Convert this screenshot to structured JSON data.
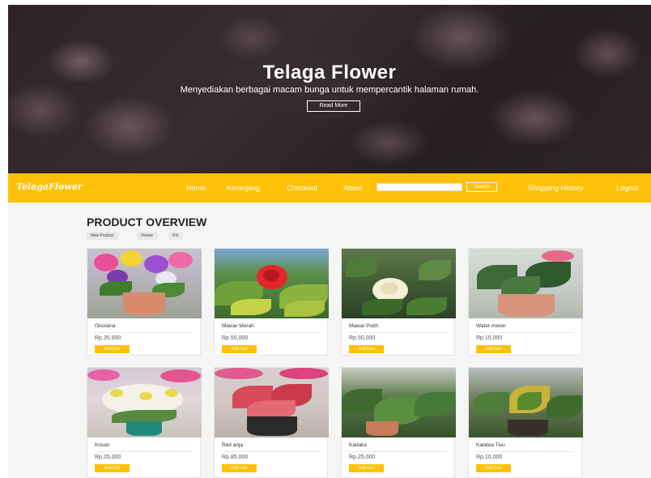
{
  "hero": {
    "title": "Telaga Flower",
    "subtitle": "Menyediakan berbagai macam bunga untuk mempercantik halaman rumah.",
    "button": "Read More"
  },
  "navbar": {
    "brand": "TelagaFlower",
    "links": [
      "Home",
      "Keranjang",
      "Checkout",
      "About"
    ],
    "search_button": "Search",
    "history": "Shopping History",
    "logout": "Logout"
  },
  "overview": {
    "title": "PRODUCT OVERVIEW",
    "filters": [
      "New Product",
      "Flower",
      "Pot"
    ]
  },
  "products": [
    {
      "name": "Gloxiana",
      "price": "Rp.35,000",
      "button": "Add Cart"
    },
    {
      "name": "Mawar Merah",
      "price": "Rp.50,000",
      "button": "Add Cart"
    },
    {
      "name": "Mawar Putih",
      "price": "Rp.50,000",
      "button": "Add Cart"
    },
    {
      "name": "Water meion",
      "price": "Rp.15,000",
      "button": "Add Cart"
    },
    {
      "name": "Krisan",
      "price": "Rp.25,000",
      "button": "Add Cart"
    },
    {
      "name": "Red anja",
      "price": "Rp.85,000",
      "button": "Add Cart"
    },
    {
      "name": "Kadaka",
      "price": "Rp.25,000",
      "button": "Add Cart"
    },
    {
      "name": "Kalatea Tisu",
      "price": "Rp.10,000",
      "button": "Add Cart"
    }
  ],
  "colors": {
    "accent": "#ffc107"
  }
}
